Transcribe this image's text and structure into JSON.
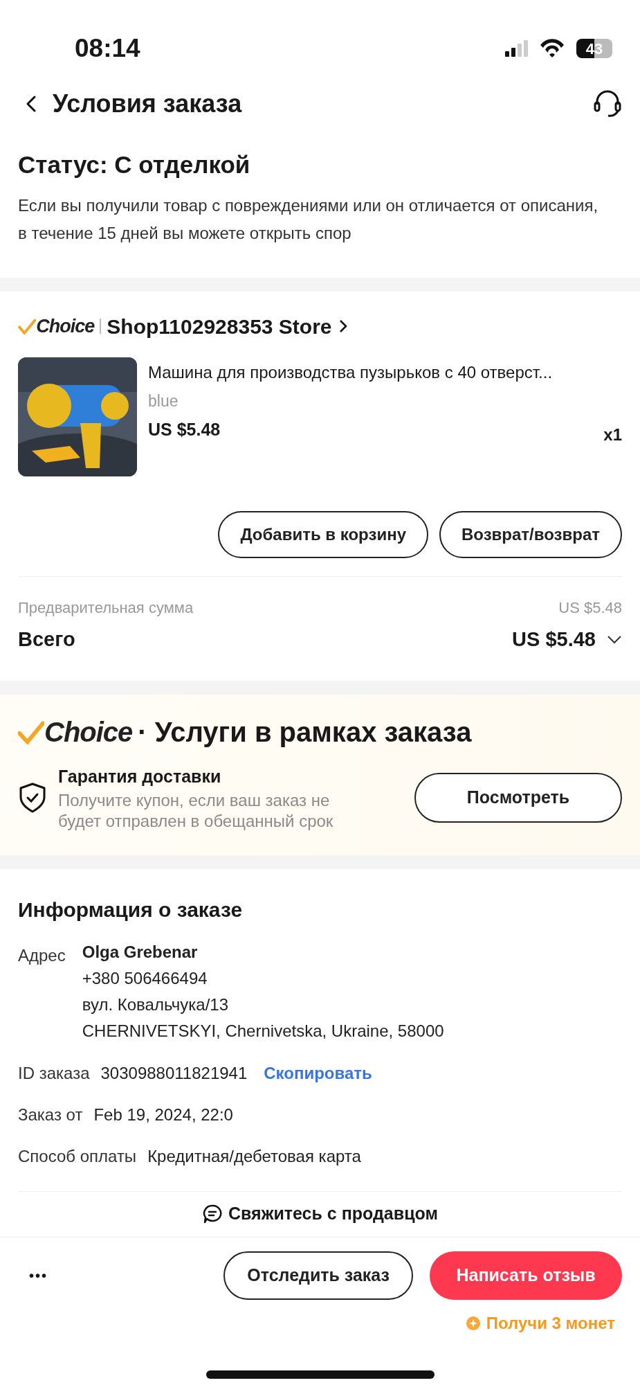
{
  "status_bar": {
    "time": "08:14",
    "battery": "43"
  },
  "header": {
    "title": "Условия заказа"
  },
  "order_status": {
    "title": "Статус: С отделкой",
    "description": "Если вы получили товар с повреждениями или он отличается от описания, в течение 15 дней вы можете открыть спор"
  },
  "shop": {
    "badge": "Choice",
    "name": "Shop1102928353 Store"
  },
  "product": {
    "title": "Машина для производства пузырьков с 40 отверст...",
    "variant": "blue",
    "price": "US $5.48",
    "quantity": "x1"
  },
  "product_buttons": [
    "Добавить в корзину",
    "Возврат/возврат"
  ],
  "summary": {
    "subtotal_label": "Предварительная сумма",
    "subtotal": "US $5.48",
    "total_label": "Всего",
    "total": "US $5.48",
    "expanded": false
  },
  "services": {
    "badge": "Choice",
    "title": "· Услуги в рамках заказа",
    "guarantee_title": "Гарантия доставки",
    "guarantee_text": "Получите купон, если ваш заказ не будет отправлен в обещанный срок",
    "button": "Посмотреть"
  },
  "order_info": {
    "title": "Информация о заказе",
    "address_label": "Адрес",
    "name": "Olga Grebenar",
    "address_lines": [
      "+380 506466494",
      "вул. Ковальчука/13",
      "CHERNIVETSKYI, Chernivetska, Ukraine, 58000"
    ],
    "rows": [
      {
        "label": "ID заказа",
        "value": "3030988011821941",
        "link": "Скопировать"
      },
      {
        "label": "Заказ от",
        "value": "Feb 19, 2024, 22:0"
      },
      {
        "label": "Способ оплаты",
        "value": "Кредитная/дебетовая карта"
      }
    ]
  },
  "contact_seller": "Свяжитесь с продавцом",
  "bottom_bar": {
    "more": "•••",
    "buttons": [
      {
        "label": "Отследить заказ",
        "kind": "outline"
      },
      {
        "label": "Написать отзыв",
        "kind": "primary"
      }
    ],
    "coins": "Получи 3 монет"
  }
}
